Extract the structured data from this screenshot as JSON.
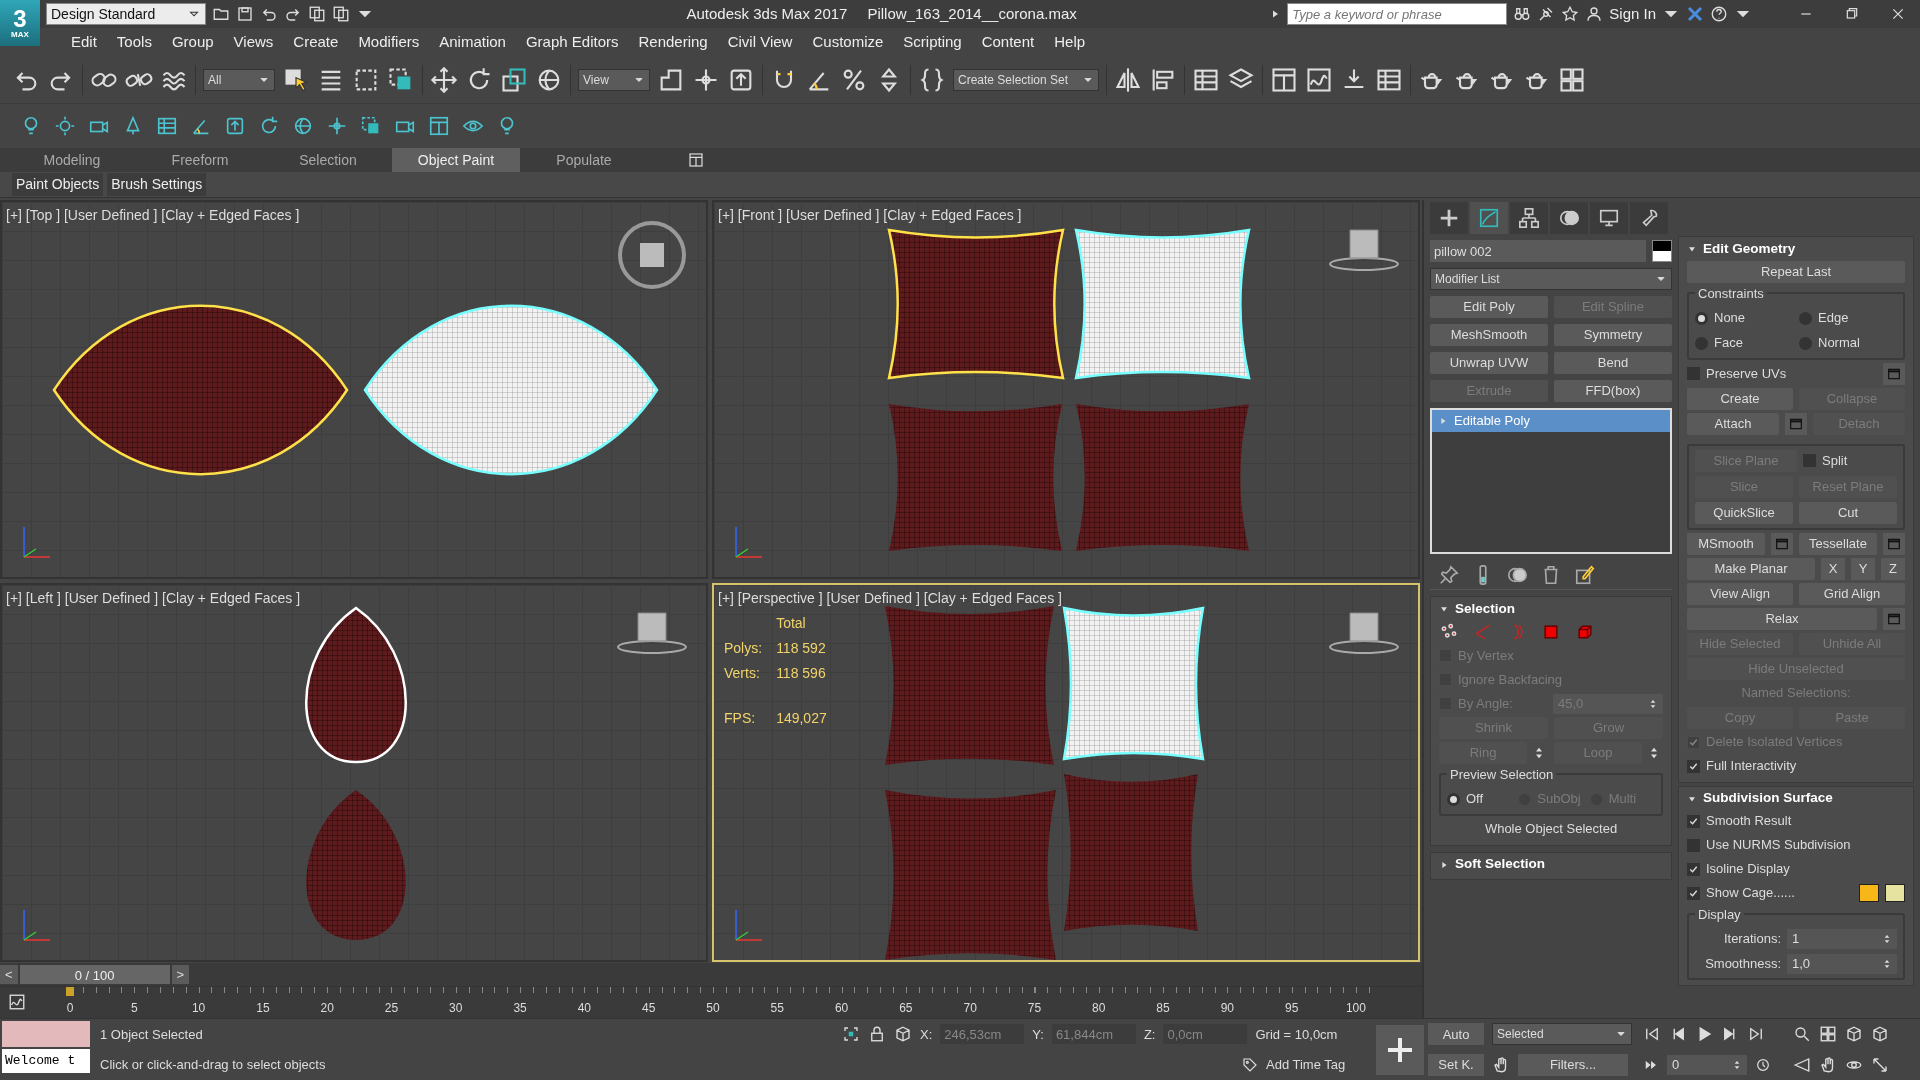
{
  "title_bar": {
    "logo": {
      "numeral": "3",
      "caption": "MAX"
    },
    "workspace": "Design Standard",
    "app": "Autodesk 3ds Max 2017",
    "file": "Pillow_163_2014__corona.max",
    "search": {
      "placeholder": "Type a keyword or phrase"
    },
    "sign_in": "Sign In"
  },
  "menu": [
    "Edit",
    "Tools",
    "Group",
    "Views",
    "Create",
    "Modifiers",
    "Animation",
    "Graph Editors",
    "Rendering",
    "Civil View",
    "Customize",
    "Scripting",
    "Content",
    "Help"
  ],
  "main_toolbar": {
    "selection_filter": "All",
    "reference_coordinate": "View",
    "selection_set": "Create Selection Set"
  },
  "ribbon": {
    "tabs": [
      {
        "label": "Modeling",
        "selected": false
      },
      {
        "label": "Freeform",
        "selected": false
      },
      {
        "label": "Selection",
        "selected": false
      },
      {
        "label": "Object Paint",
        "selected": true
      },
      {
        "label": "Populate",
        "selected": false
      }
    ],
    "panels": [
      "Paint Objects",
      "Brush Settings"
    ]
  },
  "viewports": [
    {
      "kind": "top",
      "label": "[+] [Top ] [User Defined ] [Clay + Edged Faces ]",
      "active": false
    },
    {
      "kind": "front",
      "label": "[+] [Front ] [User Defined ] [Clay + Edged Faces ]",
      "active": false
    },
    {
      "kind": "left",
      "label": "[+] [Left ] [User Defined ] [Clay + Edged Faces ]",
      "active": false
    },
    {
      "kind": "perspective",
      "label": "[+] [Perspective ] [User Defined ] [Clay + Edged Faces ]",
      "active": true,
      "stats": {
        "title": "Total",
        "rows": [
          {
            "label": "Polys:",
            "value": "118 592"
          },
          {
            "label": "Verts:",
            "value": "118 596"
          },
          {
            "label": "FPS:",
            "value": "149,027"
          }
        ]
      }
    }
  ],
  "command_panel": {
    "tabs": [
      {
        "selected": false
      },
      {
        "selected": true
      },
      {
        "selected": false
      },
      {
        "selected": false
      },
      {
        "selected": false
      },
      {
        "selected": false
      }
    ],
    "object_name": "pillow 002",
    "modifier_list": "Modifier List",
    "modifier_buttons": [
      {
        "label": "Edit Poly",
        "disabled": false
      },
      {
        "label": "Edit Spline",
        "disabled": true
      },
      {
        "label": "MeshSmooth",
        "disabled": false
      },
      {
        "label": "Symmetry",
        "disabled": false
      },
      {
        "label": "Unwrap UVW",
        "disabled": false
      },
      {
        "label": "Bend",
        "disabled": false
      },
      {
        "label": "Extrude",
        "disabled": true
      },
      {
        "label": "FFD(box)",
        "disabled": false
      }
    ],
    "stack": [
      {
        "label": "Editable Poly",
        "selected": true
      }
    ],
    "left_rollouts": [
      {
        "title": "Selection",
        "expanded": true,
        "rows": [
          [
            {
              "kind": "subobject-icons"
            }
          ],
          [
            {
              "kind": "checkbox",
              "label": "By Vertex",
              "checked": false,
              "disabled": true
            }
          ],
          [
            {
              "kind": "checkbox",
              "label": "Ignore Backfacing",
              "checked": false,
              "disabled": true
            }
          ],
          [
            {
              "kind": "checkbox",
              "label": "By Angle:",
              "checked": false,
              "disabled": true
            },
            {
              "kind": "spinner",
              "value": "45,0",
              "disabled": true
            }
          ],
          [
            {
              "kind": "button",
              "label": "Shrink",
              "disabled": true
            },
            {
              "kind": "button",
              "label": "Grow",
              "disabled": true
            }
          ],
          [
            {
              "kind": "button",
              "label": "Ring",
              "disabled": true,
              "arrows": true
            },
            {
              "kind": "button",
              "label": "Loop",
              "disabled": true,
              "arrows": true
            }
          ],
          [
            {
              "kind": "group",
              "title": "Preview Selection",
              "rows": [
                [
                  {
                    "kind": "radio",
                    "label": "Off",
                    "selected": true,
                    "disabled": false
                  },
                  {
                    "kind": "radio",
                    "label": "SubObj",
                    "selected": false,
                    "disabled": true
                  },
                  {
                    "kind": "radio",
                    "label": "Multi",
                    "selected": false,
                    "disabled": true
                  }
                ]
              ]
            }
          ],
          [
            {
              "kind": "label",
              "text": "Whole Object Selected",
              "disabled": false
            }
          ]
        ]
      },
      {
        "title": "Soft Selection",
        "expanded": false
      }
    ],
    "right_rollouts": [
      {
        "title": "Edit Geometry",
        "expanded": true,
        "rows": [
          [
            {
              "kind": "button",
              "label": "Repeat Last",
              "disabled": false
            }
          ],
          [
            {
              "kind": "group",
              "title": "Constraints",
              "rows": [
                [
                  {
                    "kind": "radio",
                    "label": "None",
                    "selected": true,
                    "disabled": false
                  },
                  {
                    "kind": "radio",
                    "label": "Edge",
                    "selected": false,
                    "disabled": false
                  }
                ],
                [
                  {
                    "kind": "radio",
                    "label": "Face",
                    "selected": false,
                    "disabled": false
                  },
                  {
                    "kind": "radio",
                    "label": "Normal",
                    "selected": false,
                    "disabled": false
                  }
                ]
              ]
            }
          ],
          [
            {
              "kind": "checkbox",
              "label": "Preserve UVs",
              "checked": false,
              "disabled": false
            },
            {
              "kind": "settings"
            }
          ],
          [
            {
              "kind": "button",
              "label": "Create",
              "disabled": false
            },
            {
              "kind": "button",
              "label": "Collapse",
              "disabled": true
            }
          ],
          [
            {
              "kind": "button",
              "label": "Attach",
              "disabled": false
            },
            {
              "kind": "settings"
            },
            {
              "kind": "button",
              "label": "Detach",
              "disabled": true
            }
          ],
          [
            {
              "kind": "group",
              "rows": [
                [
                  {
                    "kind": "button",
                    "label": "Slice Plane",
                    "disabled": true
                  },
                  {
                    "kind": "checkbox",
                    "label": "Split",
                    "checked": false,
                    "disabled": false
                  }
                ],
                [
                  {
                    "kind": "button",
                    "label": "Slice",
                    "disabled": true
                  },
                  {
                    "kind": "button",
                    "label": "Reset Plane",
                    "disabled": true
                  }
                ],
                [
                  {
                    "kind": "button",
                    "label": "QuickSlice",
                    "disabled": false
                  },
                  {
                    "kind": "button",
                    "label": "Cut",
                    "disabled": false
                  }
                ]
              ]
            }
          ],
          [
            {
              "kind": "button",
              "label": "MSmooth",
              "disabled": false
            },
            {
              "kind": "settings"
            },
            {
              "kind": "button",
              "label": "Tessellate",
              "disabled": false
            },
            {
              "kind": "settings"
            }
          ],
          [
            {
              "kind": "button",
              "label": "Make Planar",
              "disabled": false
            },
            {
              "kind": "small-button",
              "label": "X"
            },
            {
              "kind": "small-button",
              "label": "Y"
            },
            {
              "kind": "small-button",
              "label": "Z"
            }
          ],
          [
            {
              "kind": "button",
              "label": "View Align",
              "disabled": false
            },
            {
              "kind": "button",
              "label": "Grid Align",
              "disabled": false
            }
          ],
          [
            {
              "kind": "button",
              "label": "Relax",
              "disabled": false
            },
            {
              "kind": "settings"
            }
          ],
          [
            {
              "kind": "button",
              "label": "Hide Selected",
              "disabled": true
            },
            {
              "kind": "button",
              "label": "Unhide All",
              "disabled": true
            }
          ],
          [
            {
              "kind": "button",
              "label": "Hide Unselected",
              "disabled": true
            }
          ],
          [
            {
              "kind": "label",
              "text": "Named Selections:",
              "disabled": true
            }
          ],
          [
            {
              "kind": "button",
              "label": "Copy",
              "disabled": true
            },
            {
              "kind": "button",
              "label": "Paste",
              "disabled": true
            }
          ],
          [
            {
              "kind": "checkbox",
              "label": "Delete Isolated Vertices",
              "checked": true,
              "disabled": true
            }
          ],
          [
            {
              "kind": "checkbox",
              "label": "Full Interactivity",
              "checked": true,
              "disabled": false
            }
          ]
        ]
      },
      {
        "title": "Subdivision Surface",
        "expanded": true,
        "rows": [
          [
            {
              "kind": "checkbox",
              "label": "Smooth Result",
              "checked": true,
              "disabled": false
            }
          ],
          [
            {
              "kind": "checkbox",
              "label": "Use NURMS Subdivision",
              "checked": false,
              "disabled": false
            }
          ],
          [
            {
              "kind": "checkbox",
              "label": "Isoline Display",
              "checked": true,
              "disabled": false
            }
          ],
          [
            {
              "kind": "checkbox",
              "label": "Show Cage......",
              "checked": true,
              "disabled": false
            },
            {
              "kind": "swatch",
              "color": "#f7b718"
            },
            {
              "kind": "swatch",
              "color": "#e6e3a1"
            }
          ],
          [
            {
              "kind": "group",
              "title": "Display",
              "rows": [
                [
                  {
                    "kind": "spinner",
                    "label": "Iterations:",
                    "value": "1",
                    "disabled": false
                  }
                ],
                [
                  {
                    "kind": "spinner",
                    "label": "Smoothness:",
                    "value": "1,0",
                    "disabled": false
                  }
                ]
              ]
            }
          ]
        ]
      }
    ]
  },
  "time_slider": {
    "prev": "<",
    "position": "0 / 100",
    "next": ">"
  },
  "timeline": {
    "ticks": [
      "0",
      "5",
      "10",
      "15",
      "20",
      "25",
      "30",
      "35",
      "40",
      "45",
      "50",
      "55",
      "60",
      "65",
      "70",
      "75",
      "80",
      "85",
      "90",
      "95",
      "100"
    ]
  },
  "status": {
    "listener": "Welcome t",
    "selection": "1 Object Selected",
    "prompt": "Click or click-and-drag to select objects",
    "x_label": "X:",
    "x": "246,53cm",
    "y_label": "Y:",
    "y": "61,844cm",
    "z_label": "Z:",
    "z": "0,0cm",
    "grid": "Grid = 10,0cm",
    "time_tag": "Add Time Tag"
  },
  "animation": {
    "auto_key": "Auto",
    "key_filter": "Selected",
    "set_key": "Set K.",
    "filters": "Filters...",
    "frame": "0"
  }
}
